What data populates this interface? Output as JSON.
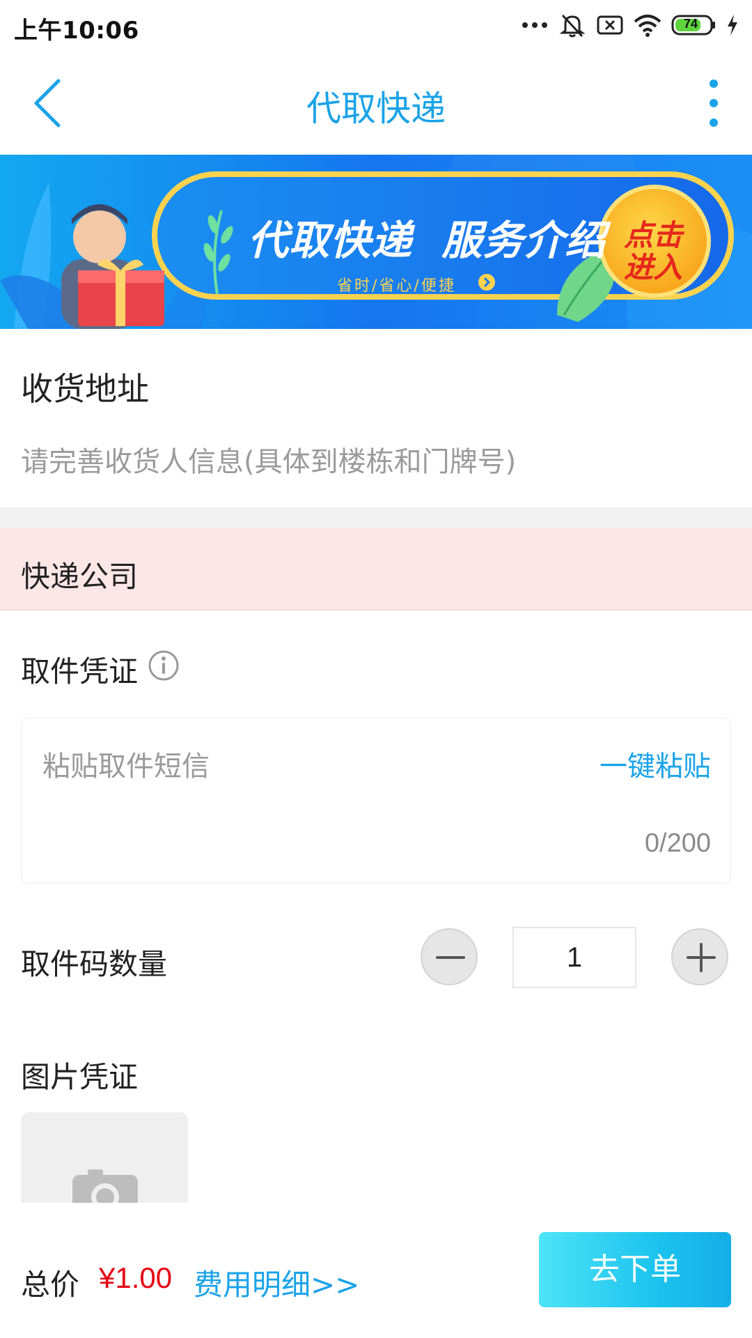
{
  "status_bar": {
    "time": "上午10:06",
    "battery": "74"
  },
  "nav": {
    "title": "代取快递",
    "accent": "#1aa3e8"
  },
  "banner": {
    "headline": "代取快递  服务介绍",
    "tagline": "省时/省心/便捷",
    "badge_line1": "点击",
    "badge_line2": "进入"
  },
  "address": {
    "label": "收货地址",
    "placeholder": "请完善收货人信息(具体到楼栋和门牌号)"
  },
  "company": {
    "label": "快递公司"
  },
  "voucher": {
    "label": "取件凭证",
    "sms_placeholder": "粘贴取件短信",
    "paste_label": "一键粘贴",
    "char_count": "0/200"
  },
  "quantity": {
    "label": "取件码数量",
    "value": "1"
  },
  "photo": {
    "label": "图片凭证"
  },
  "footer": {
    "total_label": "总价",
    "total_price": "¥1.00",
    "fee_detail": "费用明细>>",
    "submit_label": "去下单",
    "price_color": "#e60012"
  }
}
